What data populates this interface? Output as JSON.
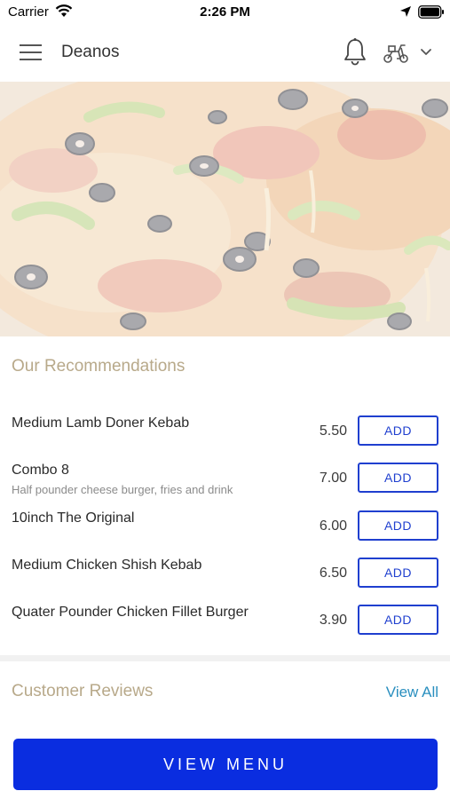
{
  "status_bar": {
    "carrier": "Carrier",
    "time": "2:26 PM"
  },
  "header": {
    "title": "Deanos",
    "icons": [
      "menu-icon",
      "bell-icon",
      "scooter-icon",
      "chevron-down-icon"
    ]
  },
  "recommendations": {
    "title": "Our Recommendations",
    "add_label": "ADD",
    "items": [
      {
        "name": "Medium Lamb Doner Kebab",
        "description": "",
        "price": "5.50"
      },
      {
        "name": "Combo 8",
        "description": "Half pounder cheese burger, fries and drink",
        "price": "7.00"
      },
      {
        "name": "10inch The Original",
        "description": "",
        "price": "6.00"
      },
      {
        "name": "Medium Chicken Shish Kebab",
        "description": "",
        "price": "6.50"
      },
      {
        "name": "Quater Pounder Chicken Fillet Burger",
        "description": "",
        "price": "3.90"
      }
    ]
  },
  "reviews": {
    "title": "Customer Reviews",
    "view_all": "View All"
  },
  "view_menu_label": "VIEW MENU",
  "colors": {
    "primary_blue": "#0a2de0",
    "section_title": "#b8a98a",
    "link": "#2a8fbf"
  }
}
